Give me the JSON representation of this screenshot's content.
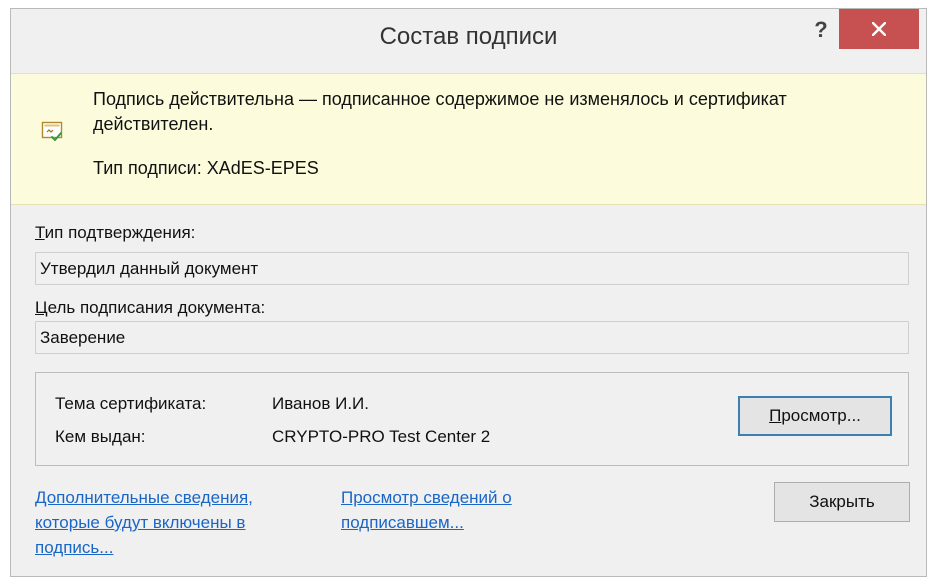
{
  "dialog": {
    "title": "Состав подписи",
    "help_label": "?"
  },
  "banner": {
    "message": "Подпись действительна — подписанное содержимое не изменялось и сертификат действителен.",
    "signature_type": "Тип подписи: XAdES-EPES"
  },
  "commitment": {
    "label_accel": "Т",
    "label_rest": "ип подтверждения:",
    "value": "Утвердил данный документ"
  },
  "purpose": {
    "label_accel": "Ц",
    "label_rest": "ель подписания документа:",
    "value": "Заверение"
  },
  "certificate": {
    "subject_label": "Тема сертификата:",
    "subject_value": "Иванов И.И.",
    "issuer_label": "Кем выдан:",
    "issuer_value": "CRYPTO-PRO Test Center 2",
    "view_button_accel": "П",
    "view_button_rest": "росмотр..."
  },
  "links": {
    "additional_info": "Дополнительные сведения, которые будут включены в подпись...",
    "signer_details": "Просмотр сведений о подписавшем..."
  },
  "footer": {
    "close_button": "Закрыть"
  },
  "colors": {
    "close_button_bg": "#c75050",
    "banner_bg": "#fcfbdc",
    "link": "#1a66c7",
    "default_button_border": "#3c7fb1"
  }
}
